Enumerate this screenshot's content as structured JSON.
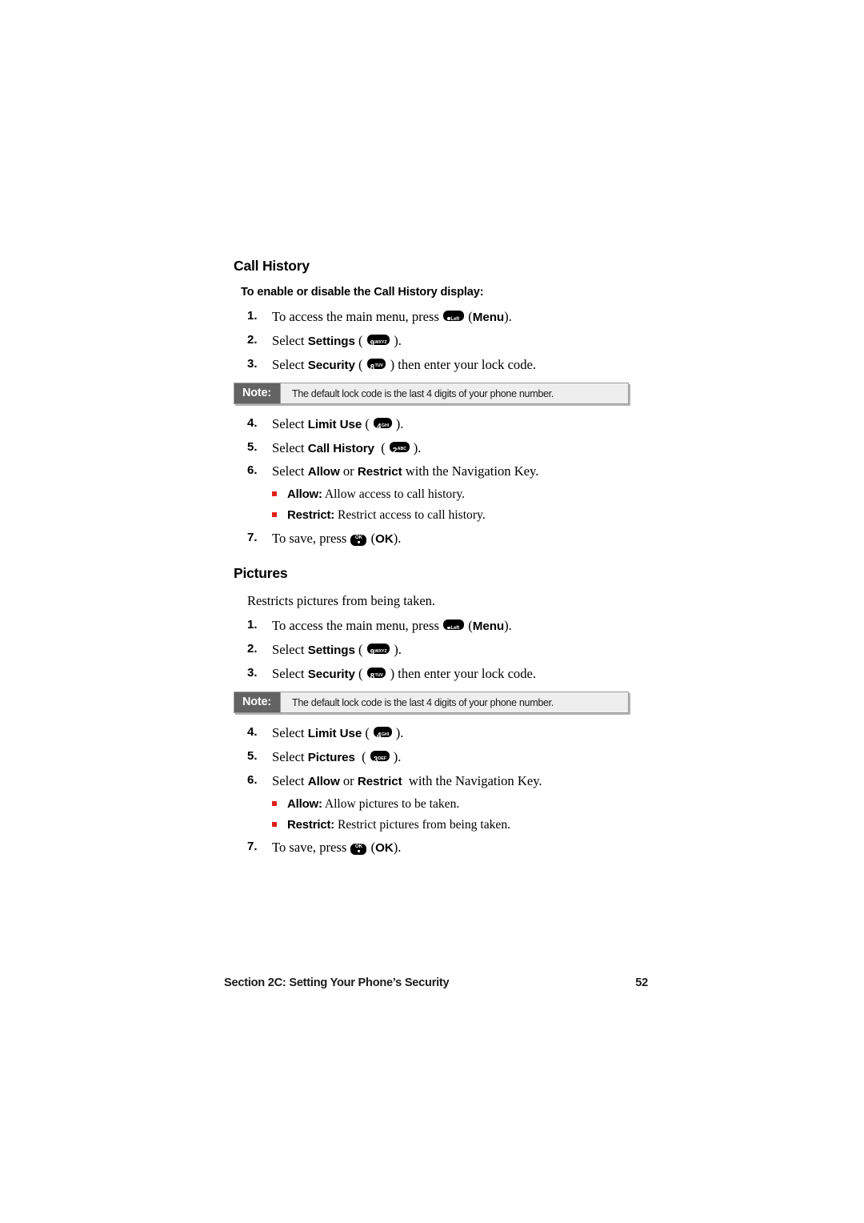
{
  "document": {
    "type": "phone-user-guide-page",
    "page_number": "52",
    "footer_section": "Section 2C: Setting Your Phone’s Security",
    "bullet_color": "#e0201b",
    "note_tag_bg": "#636363",
    "note_body_bg": "#eeeeee"
  },
  "keys": {
    "menu": {
      "glyph": "menu-softkey",
      "dot": "●",
      "label": "Left"
    },
    "nine": {
      "digit": "9",
      "letters": "WXYZ"
    },
    "eight": {
      "digit": "8",
      "letters": "TUV"
    },
    "four": {
      "digit": "4",
      "letters": "GHI"
    },
    "two": {
      "digit": "2",
      "letters": "ABC"
    },
    "three": {
      "digit": "3",
      "letters": "DEF"
    },
    "ok": {
      "top": "OK",
      "bottom": "■"
    }
  },
  "note": {
    "tag": "Note:",
    "text": "The default lock code is the last 4 digits of your phone number."
  },
  "sections": [
    {
      "id": "call-history",
      "heading": "Call History",
      "subheading": "To enable or disable the Call History display:",
      "intro": "",
      "steps_before_note": [
        {
          "num": "1.",
          "pre": "To access the main menu, press ",
          "key": "menu",
          "post_bold": "Menu",
          "pre_paren": " (",
          "post": ").",
          "bold": ""
        },
        {
          "num": "2.",
          "pre": "Select ",
          "bold": "Settings",
          "key": "nine",
          "post": ")."
        },
        {
          "num": "3.",
          "pre": "Select ",
          "bold": "Security",
          "key": "eight",
          "post": ") then enter your lock code."
        }
      ],
      "steps_after_note": [
        {
          "num": "4.",
          "pre": "Select ",
          "bold": "Limit Use",
          "key": "four",
          "post": ")."
        },
        {
          "num": "5.",
          "pre": "Select ",
          "bold": "Call History",
          "key": "two",
          "post": ")."
        }
      ],
      "step6": {
        "num": "6.",
        "pre": "Select ",
        "bold1": "Allow",
        "mid": " or ",
        "bold2": "Restrict",
        "post": " with the Navigation Key."
      },
      "bullets": [
        {
          "label": "Allow:",
          "text": " Allow access to call history."
        },
        {
          "label": "Restrict:",
          "text": " Restrict access to call history."
        }
      ],
      "step7": {
        "num": "7.",
        "pre": "To save, press ",
        "key": "ok",
        "post_bold": "OK",
        "post": ")."
      }
    },
    {
      "id": "pictures",
      "heading": "Pictures",
      "subheading": "",
      "intro": "Restricts pictures from being taken.",
      "steps_before_note": [
        {
          "num": "1.",
          "pre": "To access the main menu, press ",
          "key": "menu",
          "post_bold": "Menu",
          "post": ")."
        },
        {
          "num": "2.",
          "pre": "Select ",
          "bold": "Settings",
          "key": "nine",
          "post": ")."
        },
        {
          "num": "3.",
          "pre": "Select ",
          "bold": "Security",
          "key": "eight",
          "post": ") then enter your lock code."
        }
      ],
      "steps_after_note": [
        {
          "num": "4.",
          "pre": "Select ",
          "bold": "Limit Use",
          "key": "four",
          "post": ")."
        },
        {
          "num": "5.",
          "pre": "Select ",
          "bold": "Pictures",
          "key": "three",
          "post": ")."
        }
      ],
      "step6": {
        "num": "6.",
        "pre": "Select ",
        "bold1": "Allow",
        "mid": " or ",
        "bold2": "Restrict",
        "post": " with the Navigation Key."
      },
      "bullets": [
        {
          "label": "Allow:",
          "text": " Allow pictures to be taken."
        },
        {
          "label": "Restrict:",
          "text": " Restrict pictures from being taken."
        }
      ],
      "step7": {
        "num": "7.",
        "pre": "To save, press ",
        "key": "ok",
        "post_bold": "OK",
        "post": ")."
      }
    }
  ]
}
